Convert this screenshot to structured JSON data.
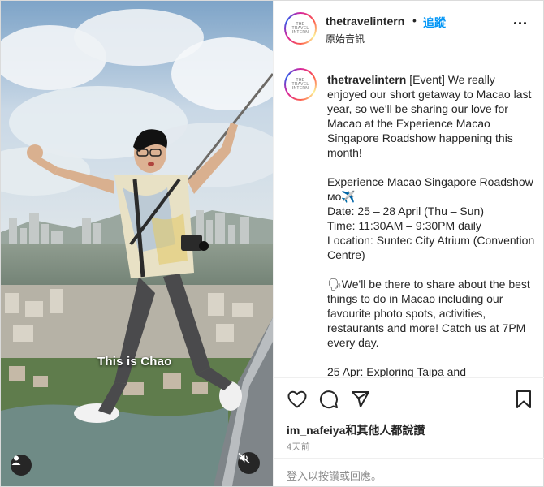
{
  "post": {
    "username": "thetravelintern",
    "separator": "•",
    "follow_label": "追蹤",
    "audio_label": "原始音訊",
    "logo_text": "THE\nTRAVEL\nINTERN"
  },
  "media": {
    "overlay_text": "This is Chao"
  },
  "caption": {
    "username": "thetravelintern",
    "text": "[Event] We really enjoyed our short getaway to Macao last year, so we'll be sharing our love for Macao at the Experience Macao Singapore Roadshow happening this month!\n\nExperience Macao Singapore Roadshow ᴍᴏ✈️\nDate: 25 – 28 April (Thu – Sun)\nTime: 11:30AM – 9:30PM daily\nLocation: Suntec City Atrium (Convention Centre)\n\n🗣We'll be there to share about the best things to do in Macao including our favourite photo spots, activities, restaurants and more! Catch us at 7PM every day.\n\n25 Apr: Exploring Taipa and"
  },
  "engagement": {
    "liker": "im_nafeiya",
    "likes_suffix": "和其他人都說讚",
    "time_ago": "4天前",
    "login_prompt": "登入以按讚或回應。"
  },
  "icons": {
    "like": "heart-icon",
    "comment": "comment-icon",
    "share": "share-icon",
    "save": "bookmark-icon",
    "more": "more-options-icon",
    "user": "user-tag-icon",
    "mute": "muted-speaker-icon"
  },
  "colors": {
    "accent": "#0095f6",
    "text": "#262626",
    "muted": "#8e8e8e",
    "border": "#efefef"
  }
}
